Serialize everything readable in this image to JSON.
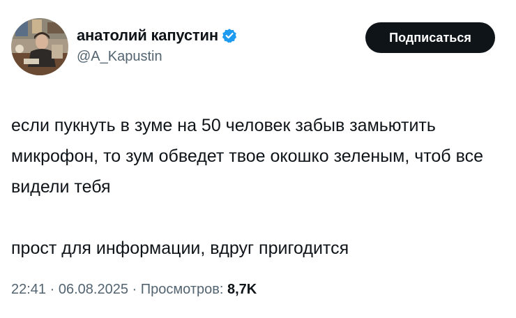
{
  "author": {
    "display_name": "анатолий капустин",
    "handle": "@A_Kapustin",
    "verified_icon": "verified-badge-icon",
    "badge_color": "#1d9bf0"
  },
  "follow_button": {
    "label": "Подписаться"
  },
  "tweet": {
    "paragraph_1": "если пукнуть в зуме на 50 человек забыв замьютить микрофон, то зум обведет твое окошко зеленым, чтоб все видели тебя",
    "paragraph_2": "прост для информации, вдруг пригодится"
  },
  "meta": {
    "time": "22:41",
    "separator": "·",
    "date": "06.08.2025",
    "views_label": "Просмотров:",
    "views_count": "8,7K"
  },
  "colors": {
    "text": "#0f1419",
    "secondary": "#536471",
    "button_bg": "#0f1419",
    "button_text": "#ffffff"
  }
}
